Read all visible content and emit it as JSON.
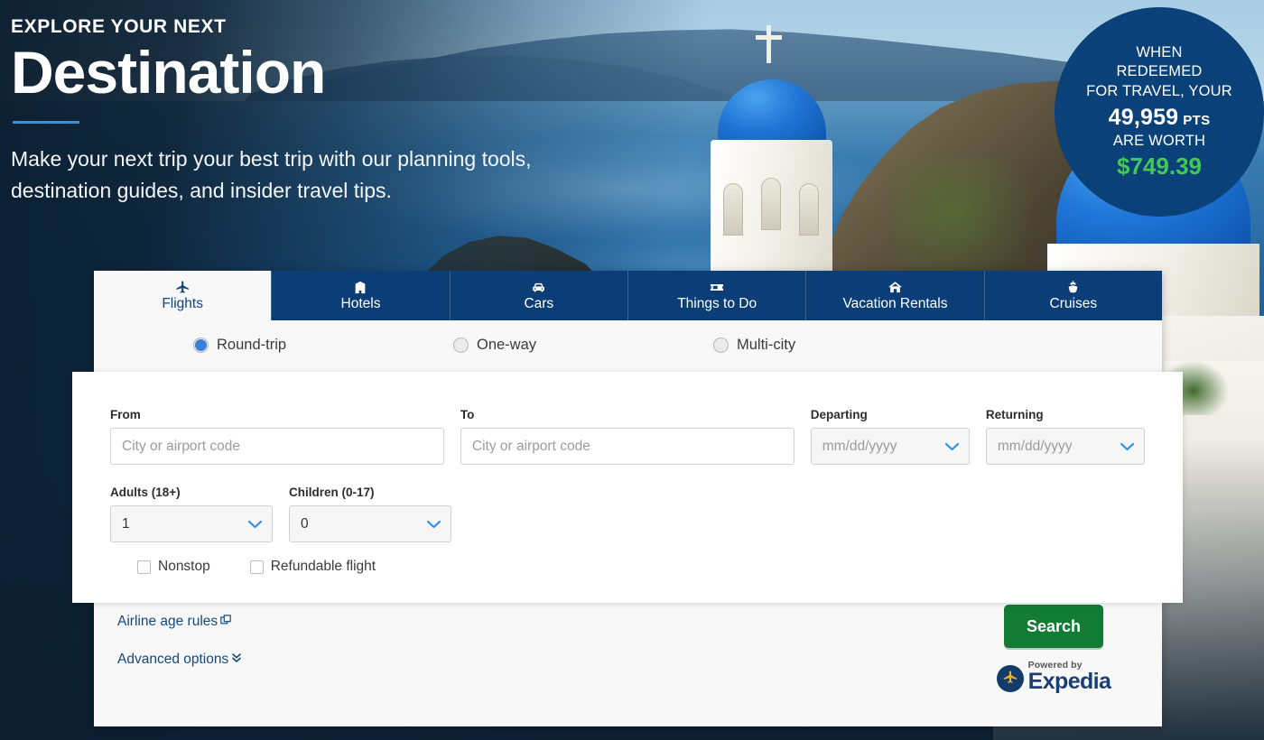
{
  "hero": {
    "eyebrow": "EXPLORE YOUR NEXT",
    "headline": "Destination",
    "subcopy": "Make your next trip your best trip with our planning tools, destination guides, and insider travel tips."
  },
  "points_badge": {
    "line1": "WHEN",
    "line2": "REDEEMED",
    "line3": "FOR TRAVEL, YOUR",
    "points": "49,959",
    "points_unit": "PTS",
    "line4": "ARE WORTH",
    "amount": "$749.39",
    "circle_color": "#0a4179",
    "amount_color": "#44c75a"
  },
  "widget": {
    "tabs": [
      {
        "label": "Flights",
        "icon": "airplane-icon",
        "active": true
      },
      {
        "label": "Hotels",
        "icon": "building-icon",
        "active": false
      },
      {
        "label": "Cars",
        "icon": "car-icon",
        "active": false
      },
      {
        "label": "Things to Do",
        "icon": "ticket-icon",
        "active": false
      },
      {
        "label": "Vacation Rentals",
        "icon": "house-icon",
        "active": false
      },
      {
        "label": "Cruises",
        "icon": "ship-icon",
        "active": false
      }
    ],
    "trip_types": [
      {
        "label": "Round-trip",
        "selected": true
      },
      {
        "label": "One-way",
        "selected": false
      },
      {
        "label": "Multi-city",
        "selected": false
      }
    ],
    "fields": {
      "from_label": "From",
      "from_placeholder": "City or airport code",
      "from_value": "",
      "to_label": "To",
      "to_placeholder": "City or airport code",
      "to_value": "",
      "departing_label": "Departing",
      "departing_placeholder": "mm/dd/yyyy",
      "departing_value": "",
      "returning_label": "Returning",
      "returning_placeholder": "mm/dd/yyyy",
      "returning_value": "",
      "adults_label": "Adults (18+)",
      "adults_value": "1",
      "children_label": "Children (0-17)",
      "children_value": "0"
    },
    "checkboxes": [
      {
        "label": "Nonstop",
        "checked": false
      },
      {
        "label": "Refundable flight",
        "checked": false
      }
    ],
    "links": [
      {
        "label": "Airline age rules",
        "icon": "external-link-icon"
      },
      {
        "label": "Advanced options",
        "icon": "double-chevron-down-icon"
      }
    ],
    "search_label": "Search",
    "search_color": "#127c35",
    "powered_by": "Powered by",
    "provider": "Expedia",
    "tab_bar_color": "#0b3d76"
  }
}
